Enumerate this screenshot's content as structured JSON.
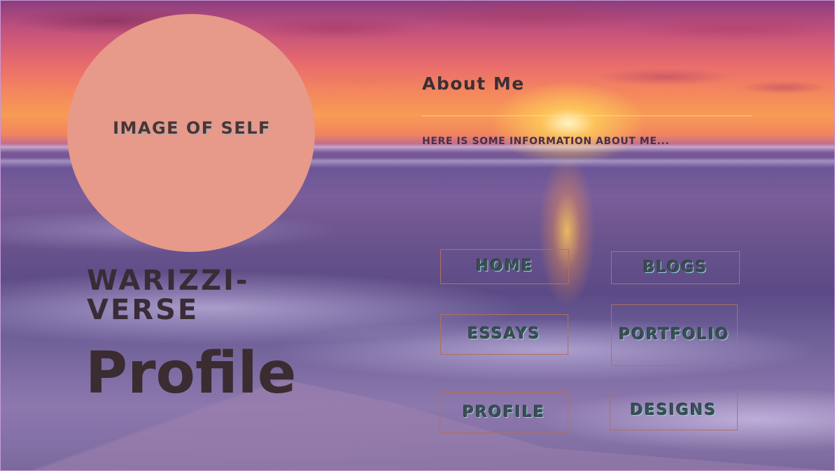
{
  "profile_image": {
    "label": "IMAGE OF SELF",
    "fill_color": "#e7998a"
  },
  "about": {
    "title": "About Me",
    "text": "HERE IS SOME INFORMATION ABOUT ME..."
  },
  "site_name": "WARIZZI-VERSE",
  "page_heading": "Profile",
  "nav": {
    "home": "HOME",
    "blogs": "BLOGS",
    "essays": "ESSAYS",
    "portfolio": "PORTFOLIO",
    "profile": "PROFILE",
    "designs": "DESIGNS"
  },
  "colors": {
    "nav_border": "#b0705e",
    "nav_text": "#3a4e55",
    "heading_text": "#3a2c30"
  },
  "background": "sunset-over-ocean-beach"
}
